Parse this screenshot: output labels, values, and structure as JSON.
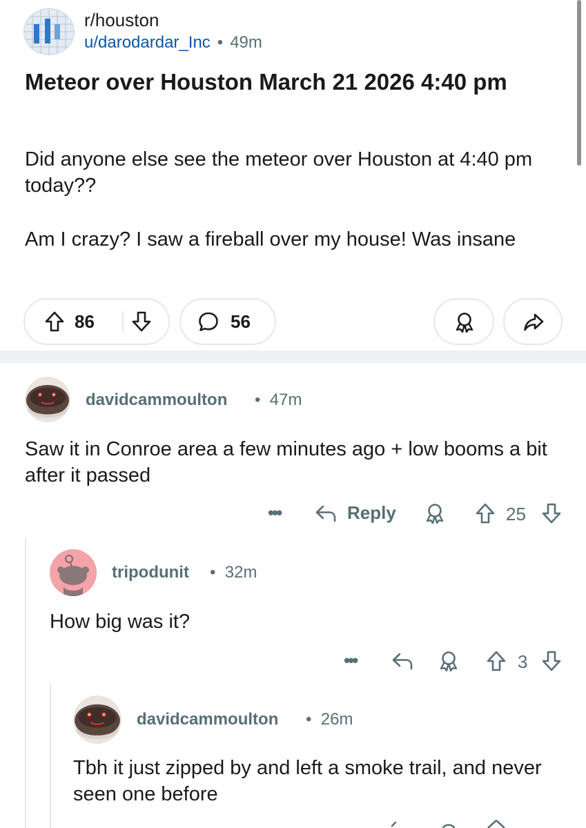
{
  "post": {
    "subreddit": "r/houston",
    "author": "u/darodardar_Inc",
    "separator": "•",
    "age": "49m",
    "title": "Meteor over Houston March 21 2026 4:40 pm",
    "body": [
      "Did anyone else see the meteor over Houston at 4:40 pm today??",
      "Am I crazy? I saw a fireball over my house! Was insane"
    ],
    "upvotes": "86",
    "comments": "56"
  },
  "comments": [
    {
      "author": "davidcammoulton",
      "age": "47m",
      "text": "Saw it in Conroe area a few minutes ago + low booms a bit after it passed",
      "more": "•••",
      "reply_label": "Reply",
      "score": "25"
    },
    {
      "author": "tripodunit",
      "age": "32m",
      "text": "How big was it?",
      "more": "•••",
      "score": "3"
    },
    {
      "author": "davidcammoulton",
      "age": "26m",
      "text": "Tbh it just zipped by and left a smoke trail, and never seen one before"
    }
  ],
  "icons": {
    "upvote": "arrow-up-icon",
    "downvote": "arrow-down-icon",
    "comment": "comment-bubble-icon",
    "award": "award-icon",
    "share": "share-arrow-icon",
    "reply": "reply-arrow-icon",
    "more": "more-dots-icon"
  },
  "colors": {
    "author_link": "#0a58a6",
    "meta_gray": "#576f76",
    "snoo_avatar_bg": "#f4a3a8",
    "separator_bg": "#eef1f4"
  }
}
